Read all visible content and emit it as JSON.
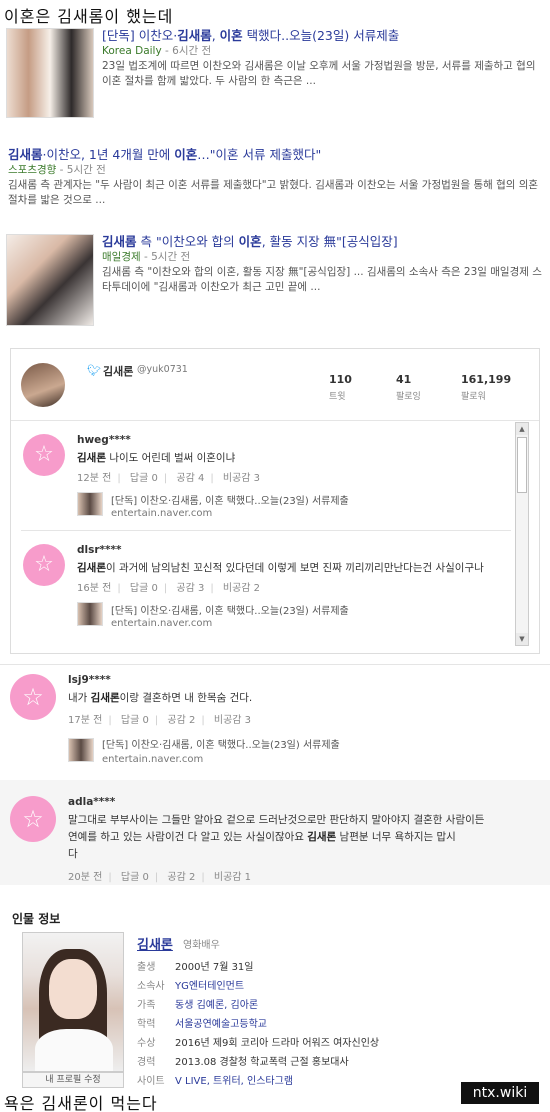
{
  "top_caption": "이혼은 김새롬이 했는데",
  "bottom_caption": "욕은 김새론이 먹는다",
  "news": [
    {
      "title_prefix": "[단독] 이찬오·",
      "title_bold1": "김새롬",
      "title_mid": ", ",
      "title_bold2": "이혼",
      "title_suffix": " 택했다..오늘(23일) 서류제출",
      "source": "Korea Daily",
      "time": " - 6시간 전",
      "desc": "23일 법조계에 따르면 이찬오와 김새롬은 이날 오후께 서울 가정법원을 방문, 서류를 제출하고 협의이혼 절차를 함께 밟았다. 두 사람의 한 측근은 ..."
    },
    {
      "title_prefix": "",
      "title_bold1": "김새롬",
      "title_mid": "·이찬오, 1년 4개월 만에 ",
      "title_bold2": "이혼",
      "title_suffix": "…\"이혼 서류 제출했다\"",
      "source": "스포츠경향",
      "time": " - 5시간 전",
      "desc": "김새롬 측 관계자는 \"두 사람이 최근 이혼 서류를 제출했다\"고 밝혔다. 김새롬과 이찬오는 서울 가정법원을 통해 협의 의혼 절차를 밟은 것으로 ..."
    },
    {
      "title_prefix": "",
      "title_bold1": "김새롬",
      "title_mid": " 측 \"이찬오와 합의 ",
      "title_bold2": "이혼",
      "title_suffix": ", 활동 지장 無\"[공식입장]",
      "source": "매일경제",
      "time": " - 5시간 전",
      "desc": "김새롬 측 \"이찬오와 합의 이혼, 활동 지장 無\"[공식입장] ... 김새롬의 소속사 측은 23일 매일경제 스타투데이에 \"김새롬과 이찬오가 최근 고민 끝에 ..."
    }
  ],
  "twitter": {
    "name": "김새론",
    "handle": "@yuk0731",
    "stats": [
      {
        "value": "110",
        "label": "트윗"
      },
      {
        "value": "41",
        "label": "팔로잉"
      },
      {
        "value": "161,199",
        "label": "팔로워"
      }
    ],
    "comments": [
      {
        "user": "hweg****",
        "bold": "김새론",
        "text": " 나이도 어린데 벌써 이혼이냐",
        "time": "12분 전",
        "reply": "답글 0",
        "like": "공감 4",
        "dislike": "비공감 3",
        "link_title": "[단독] 이찬오·김새롬, 이혼 택했다..오늘(23일) 서류제출",
        "link_url": "entertain.naver.com"
      },
      {
        "user": "dlsr****",
        "bold": "김새론",
        "text": "이 과거에 남의남친 꼬신적 있다던데 이렇게 보면 진짜 끼리끼리만난다는건 사실이구나",
        "time": "16분 전",
        "reply": "답글 0",
        "like": "공감 3",
        "dislike": "비공감 2",
        "link_title": "[단독] 이찬오·김새롬, 이혼 택했다..오늘(23일) 서류제출",
        "link_url": "entertain.naver.com"
      }
    ]
  },
  "comments": [
    {
      "user": "lsj9****",
      "pre": "내가 ",
      "bold": "김새론",
      "text": "이랑 결혼하면 내 한목숨 건다.",
      "time": "17분 전",
      "reply": "답글 0",
      "like": "공감 2",
      "dislike": "비공감 3",
      "link_title": "[단독] 이찬오·김새롬, 이혼 택했다..오늘(23일) 서류제출",
      "link_url": "entertain.naver.com"
    },
    {
      "user": "adla****",
      "line1": "말그대로 부부사이는 그들만 알아요 겉으로 드러난것으로만 판단하지 말아야지 결혼한 사람이든",
      "line2_pre": "연예를 하고 있는 사람이건 다 알고 있는 사실이잖아요 ",
      "bold": "김새론",
      "line2_post": " 남편분 너무 욕하지는 맙시",
      "line3": "다",
      "time": "20분 전",
      "reply": "답글 0",
      "like": "공감 2",
      "dislike": "비공감 1"
    }
  ],
  "person": {
    "heading": "인물 정보",
    "name": "김새론",
    "job": "영화배우",
    "edit_label": "내 프로필 수정",
    "rows": [
      {
        "key": "출생",
        "value": "2000년 7월 31일"
      },
      {
        "key": "소속사",
        "value": "YG엔터테인먼트"
      },
      {
        "key": "가족",
        "value": "동생 김예론, 김아론"
      },
      {
        "key": "학력",
        "value": "서울공연예술고등학교"
      },
      {
        "key": "수상",
        "value": "2016년 제9회 코리아 드라마 어워즈 여자신인상"
      },
      {
        "key": "경력",
        "value": "2013.08 경찰청 학교폭력 근절 홍보대사"
      },
      {
        "key": "사이트",
        "value": "V LIVE, 트위터, 인스타그램"
      }
    ]
  },
  "watermark": "ntx.wiki",
  "colors": {
    "accent": "#2a3a9a",
    "source_green": "#3a7a2a",
    "avatar_pink": "#f79ccb",
    "twitter_blue": "#1da1f2"
  }
}
